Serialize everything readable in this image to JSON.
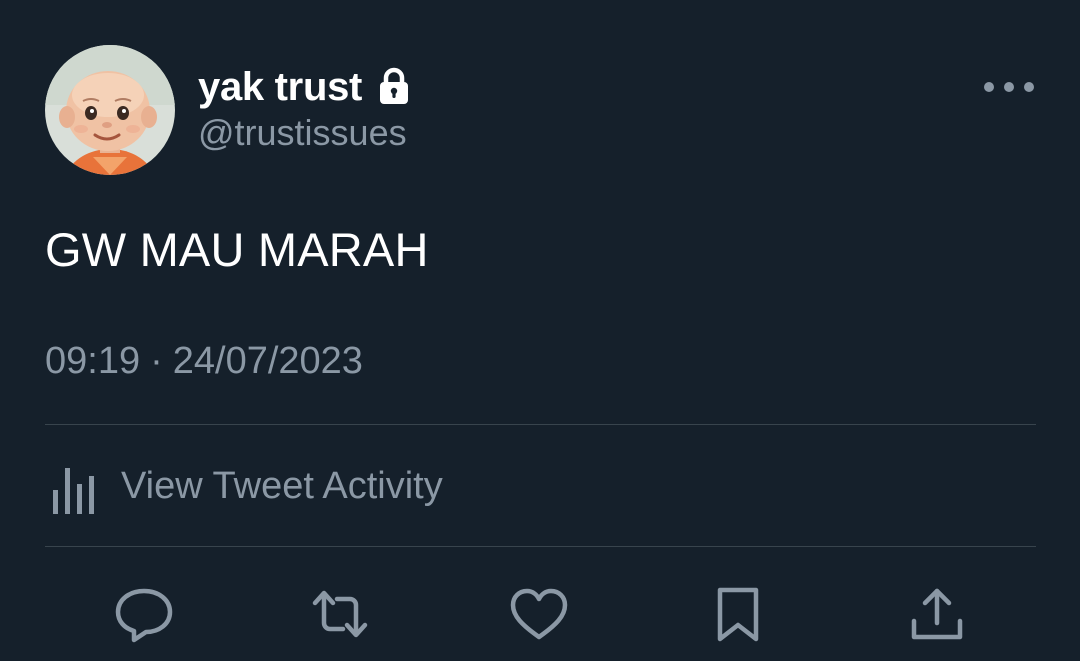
{
  "user": {
    "display_name": "yak trust",
    "handle": "@trustissues",
    "protected_icon": "lock-icon",
    "avatar_icon": "avatar"
  },
  "tweet": {
    "text": "GW MAU MARAH",
    "time": "09:19",
    "separator": "·",
    "date": "24/07/2023"
  },
  "activity": {
    "label": "View Tweet Activity",
    "icon": "bar-chart-icon"
  },
  "actions": {
    "reply": "reply-icon",
    "retweet": "retweet-icon",
    "like": "heart-icon",
    "bookmark": "bookmark-icon",
    "share": "share-icon"
  },
  "menu": {
    "icon": "more-icon"
  },
  "colors": {
    "background": "#15202b",
    "primary_text": "#ffffff",
    "secondary_text": "#8b98a5",
    "divider": "#38444d",
    "icon": "#8b98a5"
  }
}
